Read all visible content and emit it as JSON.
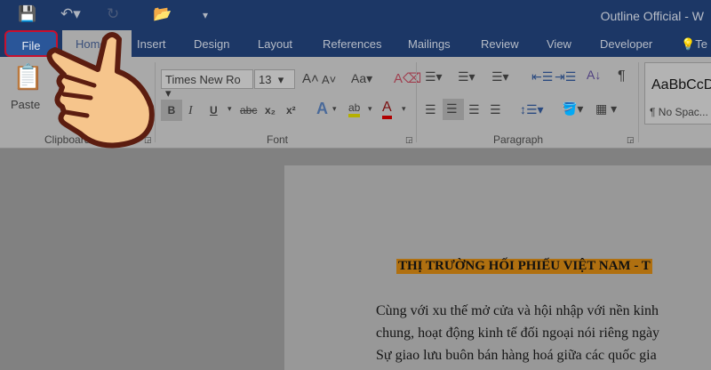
{
  "titlebar": {
    "title": "Outline Official - W"
  },
  "tabs": {
    "file": "File",
    "home": "Home",
    "insert": "Insert",
    "design": "Design",
    "layout": "Layout",
    "references": "References",
    "mailings": "Mailings",
    "review": "Review",
    "view": "View",
    "developer": "Developer",
    "tell": "Te"
  },
  "ribbon": {
    "paste": "Paste",
    "clipboard": "Clipboard",
    "font_name": "Times New Ro",
    "font_size": "13",
    "font": "Font",
    "paragraph": "Paragraph",
    "bold": "B",
    "italic": "I",
    "underline": "U",
    "strike": "abc",
    "sub": "x₂",
    "sup": "x²",
    "case": "Aa",
    "style_preview": "AaBbCcD",
    "style_name": "¶ No Spac..."
  },
  "document": {
    "heading": "THỊ TRƯỜNG HỐI PHIẾU VIỆT NAM - T",
    "lines": [
      "Cùng với xu thế mở cửa và hội nhập với nền kinh",
      "chung, hoạt động kinh tế đối ngoại nói riêng ngày",
      "Sự giao lưu buôn bán hàng hoá giữa các quốc gia"
    ]
  },
  "colors": {
    "titlebar": "#1c3766",
    "file_tab": "#2a5699",
    "highlight": "#b07010",
    "font_color": "#b00000"
  }
}
